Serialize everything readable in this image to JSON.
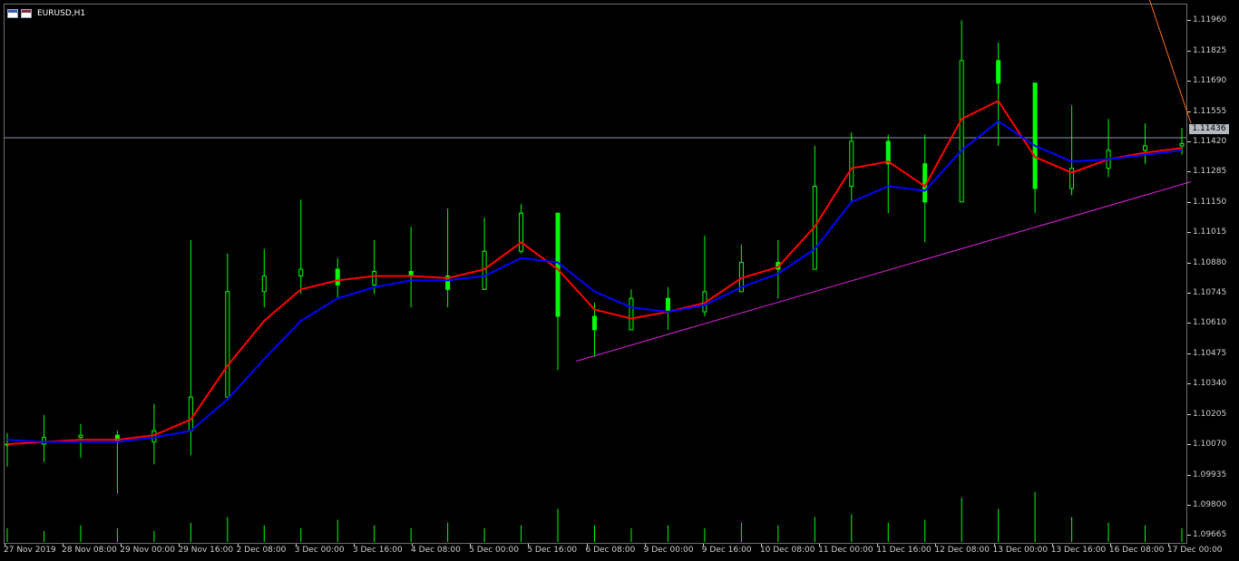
{
  "symbol": "EURUSD,H1",
  "icons": [
    "chart-window-icon",
    "chart-window-icon-alt"
  ],
  "colors": {
    "background": "#000000",
    "bull_candle": "#00ff00",
    "bear_candle": "#00ff00",
    "volume": "#00ff00",
    "ma_fast": "#ff0000",
    "ma_slow": "#0000ff",
    "trend_upper": "#ff6a1a",
    "trend_lower": "#e020e0",
    "bid_line": "#8f9aa8",
    "axis_text": "#d0d0d0"
  },
  "price_badge": "1.11436",
  "price_axis": {
    "ticks": [
      "1.11960",
      "1.11825",
      "1.11690",
      "1.11555",
      "1.11420",
      "1.11285",
      "1.11150",
      "1.11015",
      "1.10880",
      "1.10745",
      "1.10610",
      "1.10475",
      "1.10340",
      "1.10205",
      "1.10070",
      "1.09935",
      "1.09800",
      "1.09665"
    ]
  },
  "time_axis": {
    "ticks": [
      "27 Nov 2019",
      "28 Nov 08:00",
      "29 Nov 00:00",
      "29 Nov 16:00",
      "2 Dec 08:00",
      "3 Dec 00:00",
      "3 Dec 16:00",
      "4 Dec 08:00",
      "5 Dec 00:00",
      "5 Dec 16:00",
      "6 Dec 08:00",
      "9 Dec 00:00",
      "9 Dec 16:00",
      "10 Dec 08:00",
      "11 Dec 00:00",
      "11 Dec 16:00",
      "12 Dec 08:00",
      "13 Dec 00:00",
      "13 Dec 16:00",
      "16 Dec 08:00",
      "17 Dec 00:00"
    ]
  },
  "chart_data": {
    "type": "line",
    "title": "EURUSD,H1",
    "ylim": [
      1.0963,
      1.1203
    ],
    "x_categories": [
      "27 Nov 2019",
      "28 Nov 08:00",
      "29 Nov 00:00",
      "29 Nov 16:00",
      "2 Dec 08:00",
      "3 Dec 00:00",
      "3 Dec 16:00",
      "4 Dec 08:00",
      "5 Dec 00:00",
      "5 Dec 16:00",
      "6 Dec 08:00",
      "9 Dec 00:00",
      "9 Dec 16:00",
      "10 Dec 08:00",
      "11 Dec 00:00",
      "11 Dec 16:00",
      "12 Dec 08:00",
      "13 Dec 00:00",
      "13 Dec 16:00",
      "16 Dec 08:00",
      "17 Dec 00:00"
    ],
    "price_close": [
      1.1007,
      1.101,
      1.1011,
      1.1008,
      1.1013,
      1.1028,
      1.1075,
      1.1082,
      1.1085,
      1.1078,
      1.1084,
      1.1082,
      1.1076,
      1.1093,
      1.111,
      1.1064,
      1.1058,
      1.1072,
      1.1066,
      1.1075,
      1.1088,
      1.1085,
      1.1122,
      1.1142,
      1.1132,
      1.1115,
      1.1178,
      1.1168,
      1.1121,
      1.113,
      1.1138,
      1.114,
      1.1141
    ],
    "price_high": [
      1.1012,
      1.102,
      1.1016,
      1.1013,
      1.1025,
      1.1098,
      1.1092,
      1.1094,
      1.1116,
      1.109,
      1.1098,
      1.1104,
      1.1112,
      1.1108,
      1.1114,
      1.108,
      1.107,
      1.1076,
      1.1077,
      1.11,
      1.1096,
      1.1098,
      1.114,
      1.1146,
      1.1145,
      1.1145,
      1.1196,
      1.1186,
      1.1146,
      1.1158,
      1.1152,
      1.115,
      1.1148
    ],
    "price_low": [
      1.0997,
      1.0999,
      1.1001,
      1.0985,
      1.0998,
      1.1002,
      1.1062,
      1.1068,
      1.1074,
      1.1072,
      1.1074,
      1.1068,
      1.1068,
      1.1078,
      1.1092,
      1.104,
      1.1046,
      1.106,
      1.1058,
      1.1064,
      1.1079,
      1.1072,
      1.1093,
      1.1115,
      1.111,
      1.1097,
      1.1115,
      1.114,
      1.111,
      1.1118,
      1.1126,
      1.1132,
      1.1136
    ],
    "series": [
      {
        "name": "",
        "values": [
          1.1007,
          1.1008,
          1.1009,
          1.1009,
          1.1011,
          1.1018,
          1.1042,
          1.1062,
          1.1076,
          1.108,
          1.1082,
          1.1082,
          1.1081,
          1.1085,
          1.1097,
          1.1085,
          1.1067,
          1.1063,
          1.1066,
          1.107,
          1.1081,
          1.1086,
          1.1104,
          1.113,
          1.1133,
          1.1122,
          1.1152,
          1.116,
          1.1135,
          1.1128,
          1.1134,
          1.1137,
          1.1139
        ]
      },
      {
        "name": "",
        "values": [
          1.1009,
          1.1008,
          1.1008,
          1.1008,
          1.101,
          1.1013,
          1.1027,
          1.1045,
          1.1062,
          1.1072,
          1.1077,
          1.108,
          1.108,
          1.1082,
          1.109,
          1.1088,
          1.1075,
          1.1068,
          1.1066,
          1.1069,
          1.1077,
          1.1083,
          1.1094,
          1.1115,
          1.1122,
          1.112,
          1.1138,
          1.1151,
          1.114,
          1.1133,
          1.1134,
          1.1136,
          1.1138
        ]
      }
    ],
    "trendlines": [
      {
        "from": [
          15.4,
          1.1974
        ],
        "to": [
          33,
          1.115
        ]
      },
      {
        "from": [
          15.5,
          1.1044
        ],
        "to": [
          33,
          1.1124
        ]
      }
    ],
    "bid_line": 1.11436,
    "volume": [
      5,
      4,
      6,
      5,
      4,
      7,
      9,
      6,
      5,
      8,
      6,
      5,
      7,
      5,
      6,
      12,
      6,
      5,
      6,
      5,
      7,
      6,
      9,
      10,
      7,
      8,
      16,
      12,
      18,
      9,
      7,
      6,
      5
    ],
    "grid": false
  }
}
